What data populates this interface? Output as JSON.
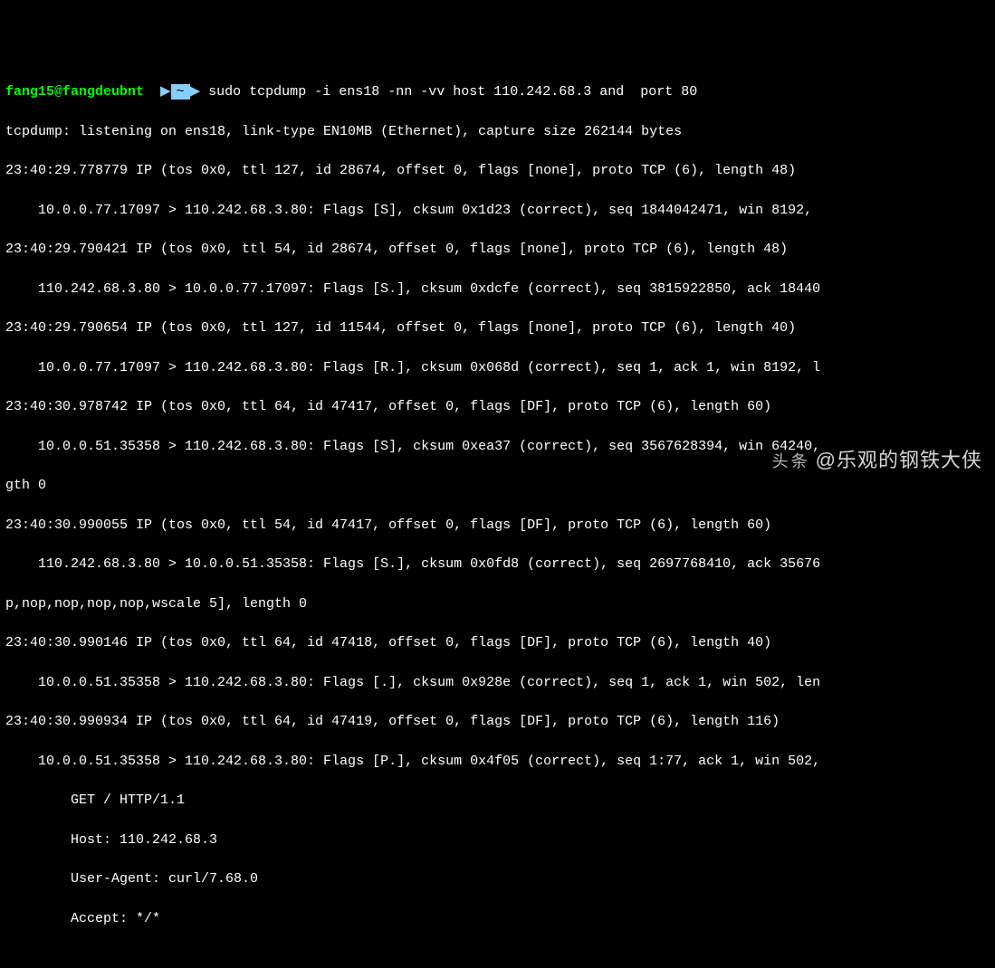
{
  "prompt": {
    "user": "fang15@fangdeubnt",
    "path": "~",
    "command": "sudo tcpdump -i ens18 -nn -vv host 110.242.68.3 and  port 80"
  },
  "lines": {
    "l0": "tcpdump: listening on ens18, link-type EN10MB (Ethernet), capture size 262144 bytes",
    "l1": "23:40:29.778779 IP (tos 0x0, ttl 127, id 28674, offset 0, flags [none], proto TCP (6), length 48)",
    "l2": "    10.0.0.77.17097 > 110.242.68.3.80: Flags [S], cksum 0x1d23 (correct), seq 1844042471, win 8192,",
    "l3": "23:40:29.790421 IP (tos 0x0, ttl 54, id 28674, offset 0, flags [none], proto TCP (6), length 48)",
    "l4": "    110.242.68.3.80 > 10.0.0.77.17097: Flags [S.], cksum 0xdcfe (correct), seq 3815922850, ack 18440",
    "l5": "23:40:29.790654 IP (tos 0x0, ttl 127, id 11544, offset 0, flags [none], proto TCP (6), length 40)",
    "l6": "    10.0.0.77.17097 > 110.242.68.3.80: Flags [R.], cksum 0x068d (correct), seq 1, ack 1, win 8192, l",
    "l7": "23:40:30.978742 IP (tos 0x0, ttl 64, id 47417, offset 0, flags [DF], proto TCP (6), length 60)",
    "l8": "    10.0.0.51.35358 > 110.242.68.3.80: Flags [S], cksum 0xea37 (correct), seq 3567628394, win 64240,",
    "l9": "gth 0",
    "l10": "23:40:30.990055 IP (tos 0x0, ttl 54, id 47417, offset 0, flags [DF], proto TCP (6), length 60)",
    "l11": "    110.242.68.3.80 > 10.0.0.51.35358: Flags [S.], cksum 0x0fd8 (correct), seq 2697768410, ack 35676",
    "l12": "p,nop,nop,nop,nop,wscale 5], length 0",
    "l13": "23:40:30.990146 IP (tos 0x0, ttl 64, id 47418, offset 0, flags [DF], proto TCP (6), length 40)",
    "l14": "    10.0.0.51.35358 > 110.242.68.3.80: Flags [.], cksum 0x928e (correct), seq 1, ack 1, win 502, len",
    "l15": "23:40:30.990934 IP (tos 0x0, ttl 64, id 47419, offset 0, flags [DF], proto TCP (6), length 116)",
    "l16": "    10.0.0.51.35358 > 110.242.68.3.80: Flags [P.], cksum 0x4f05 (correct), seq 1:77, ack 1, win 502,",
    "l17": "        GET / HTTP/1.1",
    "l18": "        Host: 110.242.68.3",
    "l19": "        User-Agent: curl/7.68.0",
    "l20": "        Accept: */*"
  },
  "watermark": {
    "brand": "头条",
    "author": "@乐观的钢铁大侠"
  }
}
